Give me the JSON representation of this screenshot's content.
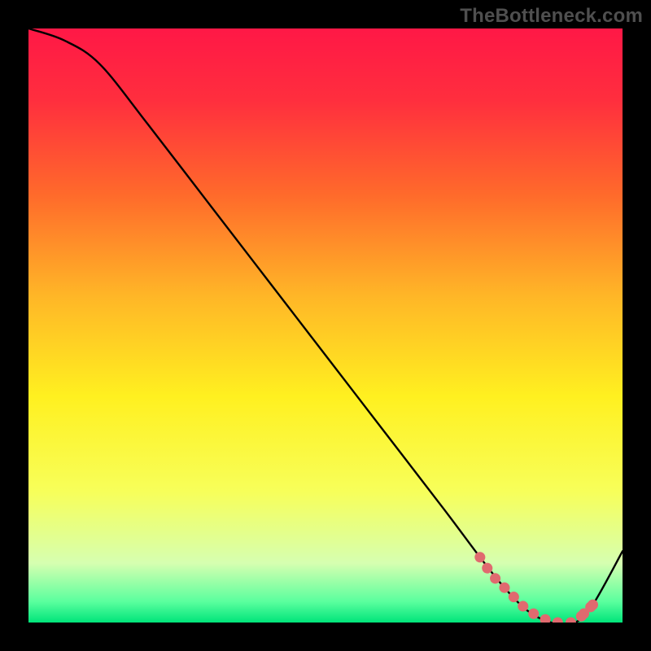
{
  "watermark": "TheBottleneck.com",
  "chart_data": {
    "type": "line",
    "title": "",
    "xlabel": "",
    "ylabel": "",
    "xlim": [
      0,
      100
    ],
    "ylim": [
      0,
      100
    ],
    "gradient_stops": [
      {
        "offset": 0.0,
        "color": "#ff1846"
      },
      {
        "offset": 0.12,
        "color": "#ff2e3e"
      },
      {
        "offset": 0.28,
        "color": "#ff6a2b"
      },
      {
        "offset": 0.45,
        "color": "#ffb627"
      },
      {
        "offset": 0.62,
        "color": "#fff020"
      },
      {
        "offset": 0.78,
        "color": "#f7ff5a"
      },
      {
        "offset": 0.9,
        "color": "#d6ffb0"
      },
      {
        "offset": 0.965,
        "color": "#5aff9e"
      },
      {
        "offset": 1.0,
        "color": "#00e47a"
      }
    ],
    "series": [
      {
        "name": "curve",
        "x": [
          0,
          6,
          12,
          20,
          30,
          40,
          50,
          60,
          70,
          76,
          80,
          84,
          88,
          92,
          95,
          100
        ],
        "y": [
          100,
          98,
          94,
          84,
          71,
          58,
          45,
          32,
          19,
          11,
          6,
          2,
          0,
          0,
          3,
          12
        ]
      }
    ],
    "highlight_band": {
      "name": "optimal-zone",
      "color": "#e06a6f",
      "points": [
        {
          "x": 76,
          "y": 11
        },
        {
          "x": 78,
          "y": 8
        },
        {
          "x": 80,
          "y": 6
        },
        {
          "x": 82,
          "y": 4
        },
        {
          "x": 84,
          "y": 2
        },
        {
          "x": 86,
          "y": 1
        },
        {
          "x": 88,
          "y": 0
        },
        {
          "x": 90,
          "y": 0
        },
        {
          "x": 92,
          "y": 0
        },
        {
          "x": 93.5,
          "y": 1.5
        },
        {
          "x": 95,
          "y": 3
        }
      ]
    }
  }
}
